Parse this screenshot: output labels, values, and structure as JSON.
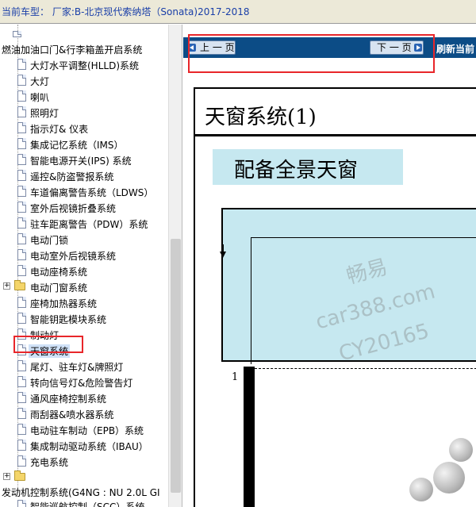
{
  "window": {
    "title": "当前车型： 厂家:B-北京现代索纳塔（Sonata)2017-2018"
  },
  "tree": {
    "items": [
      {
        "label": "燃油加油口门&行李箱盖开启系统",
        "kind": "text",
        "level": 0
      },
      {
        "label": "大灯水平调整(HLLD)系统",
        "kind": "doc"
      },
      {
        "label": "大灯",
        "kind": "doc"
      },
      {
        "label": "喇叭",
        "kind": "doc"
      },
      {
        "label": "照明灯",
        "kind": "doc"
      },
      {
        "label": "指示灯& 仪表",
        "kind": "doc"
      },
      {
        "label": "集成记忆系统（IMS）",
        "kind": "doc"
      },
      {
        "label": "智能电源开关(IPS) 系统",
        "kind": "doc"
      },
      {
        "label": "遥控&防盗警报系统",
        "kind": "doc"
      },
      {
        "label": "车道偏离警告系统（LDWS）",
        "kind": "doc"
      },
      {
        "label": "室外后视镜折叠系统",
        "kind": "doc"
      },
      {
        "label": "驻车距离警告（PDW）系统",
        "kind": "doc"
      },
      {
        "label": "电动门锁",
        "kind": "doc"
      },
      {
        "label": "电动室外后视镜系统",
        "kind": "doc"
      },
      {
        "label": "电动座椅系统",
        "kind": "doc"
      },
      {
        "label": "电动门窗系统",
        "kind": "folder"
      },
      {
        "label": "座椅加热器系统",
        "kind": "doc"
      },
      {
        "label": "智能钥匙模块系统",
        "kind": "doc"
      },
      {
        "label": "制动灯",
        "kind": "doc"
      },
      {
        "label": "天窗系统",
        "kind": "doc",
        "selected": true
      },
      {
        "label": "尾灯、驻车灯&牌照灯",
        "kind": "doc"
      },
      {
        "label": "转向信号灯&危险警告灯",
        "kind": "doc"
      },
      {
        "label": "通风座椅控制系统",
        "kind": "doc"
      },
      {
        "label": "雨刮器&喷水器系统",
        "kind": "doc"
      },
      {
        "label": "电动驻车制动（EPB）系统",
        "kind": "doc"
      },
      {
        "label": "集成制动驱动系统（IBAU）",
        "kind": "doc"
      },
      {
        "label": "充电系统",
        "kind": "doc"
      },
      {
        "label": "",
        "kind": "folder-collapsed"
      },
      {
        "label": "发动机控制系统(G4NG : NU 2.0L GI",
        "kind": "text",
        "level": 0
      },
      {
        "label": "智能巡航控制（SCC）系统",
        "kind": "doc"
      }
    ]
  },
  "nav": {
    "prev_label": "上 一 页",
    "next_label": "下 一 页",
    "refresh_label": "刷新当前"
  },
  "document": {
    "title": "天窗系统(1)",
    "subtitle": "配备全景天窗",
    "callout_number": "1",
    "watermark_line1": "畅易",
    "watermark_line2": "car388.com",
    "watermark_line3": "CY20165"
  },
  "colors": {
    "title_text": "#1a3fa8",
    "navbar": "#0c4c86",
    "highlight_red": "#e8262a",
    "diagram_fill": "#c6e8f0",
    "selection": "#cfe1f7"
  }
}
